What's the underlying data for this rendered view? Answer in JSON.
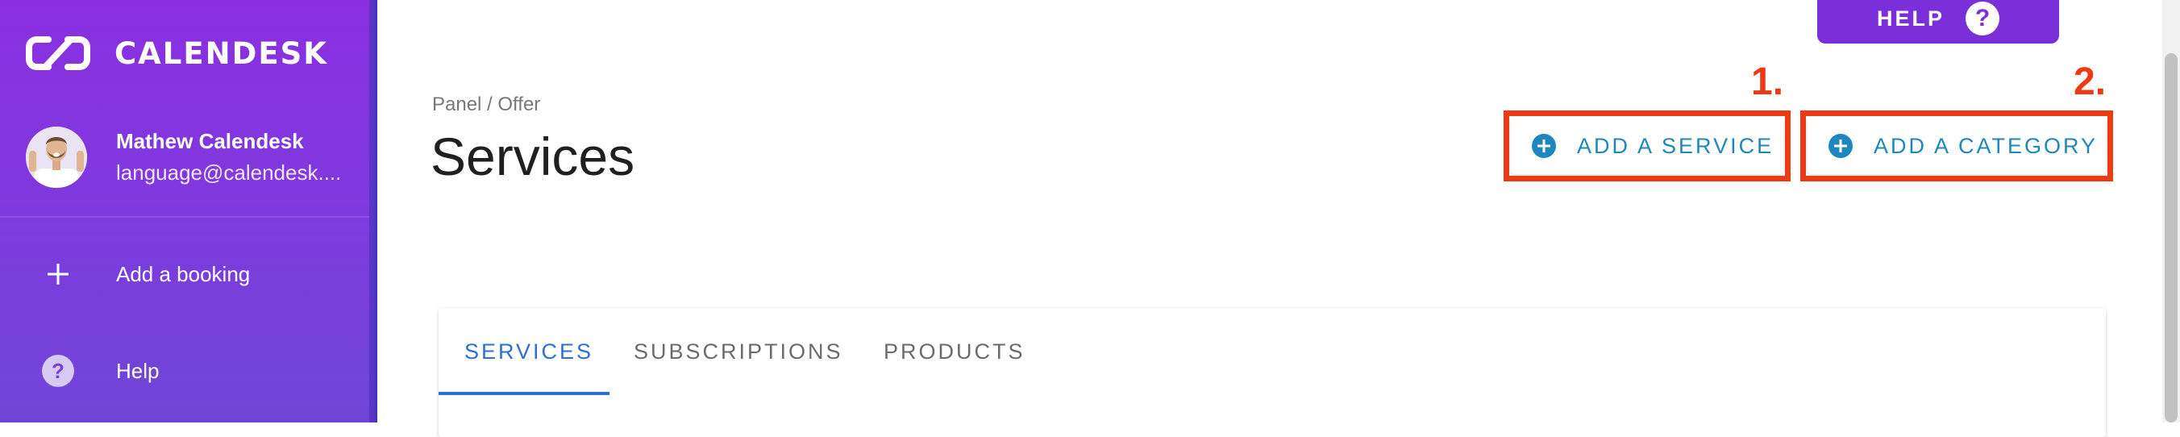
{
  "sidebar": {
    "brand": {
      "logo_icon": "calendesk-logo-icon",
      "name": "CALENDESK"
    },
    "profile": {
      "name": "Mathew Calendesk",
      "email": "language@calendesk...."
    },
    "items": [
      {
        "label": "Add a booking",
        "icon": "plus-icon"
      },
      {
        "label": "Help",
        "icon": "question-circle-icon"
      }
    ],
    "colors": {
      "gradient_top": "#8a2fe0",
      "gradient_bottom": "#6e46d6"
    }
  },
  "header": {
    "help_label": "HELP",
    "help_icon": "question-circle-icon",
    "help_color": "#7b2fd8"
  },
  "page": {
    "breadcrumb": "Panel / Offer",
    "title": "Services"
  },
  "actions": {
    "add_service_label": "ADD A SERVICE",
    "add_category_label": "ADD A CATEGORY",
    "icon": "plus-circle-icon",
    "color": "#1e88be"
  },
  "annotations": {
    "marker_1": "1.",
    "marker_2": "2.",
    "color": "#ec3a15"
  },
  "tabs": [
    {
      "label": "SERVICES",
      "active": true
    },
    {
      "label": "SUBSCRIPTIONS",
      "active": false
    },
    {
      "label": "PRODUCTS",
      "active": false
    }
  ],
  "accent_color": "#2d6fd3"
}
